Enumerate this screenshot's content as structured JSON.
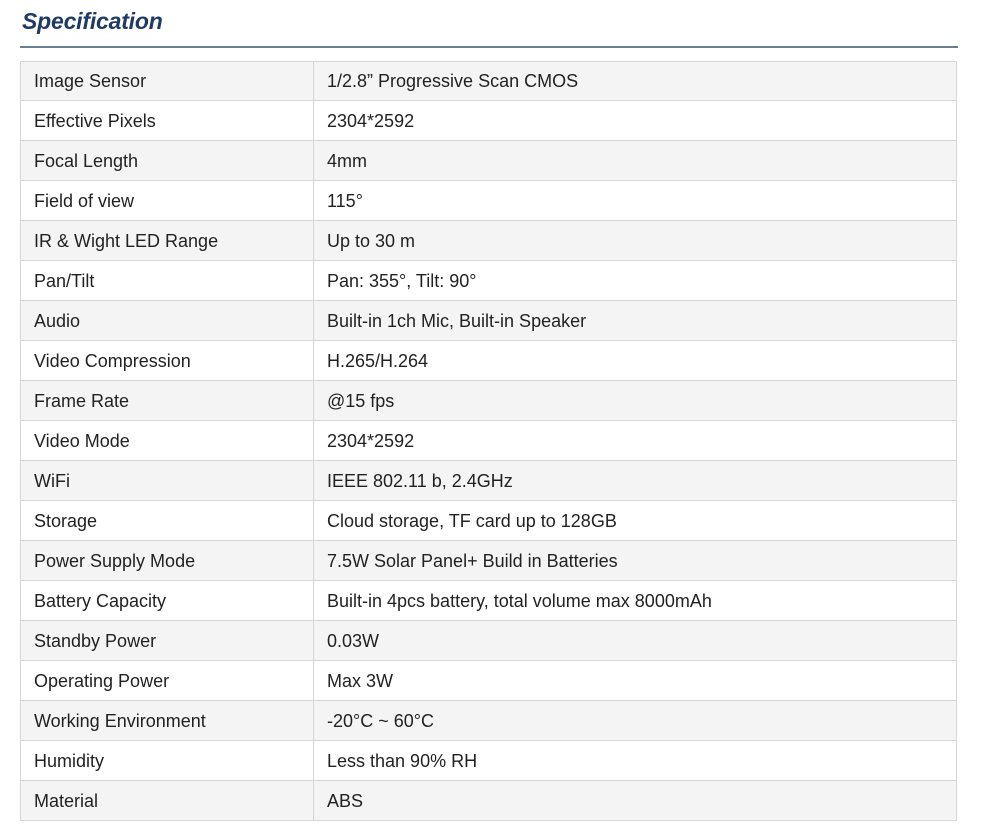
{
  "section": {
    "title": "Specification"
  },
  "spec_table": {
    "rows": [
      {
        "label": "Image Sensor",
        "value": "1/2.8” Progressive Scan CMOS"
      },
      {
        "label": "Effective Pixels",
        "value": "2304*2592"
      },
      {
        "label": "Focal Length",
        "value": "4mm"
      },
      {
        "label": "Field of view",
        "value": "115°"
      },
      {
        "label": "IR & Wight LED Range",
        "value": "Up to 30 m"
      },
      {
        "label": "Pan/Tilt",
        "value": "Pan: 355°, Tilt: 90°"
      },
      {
        "label": "Audio",
        "value": "Built-in 1ch Mic, Built-in Speaker"
      },
      {
        "label": "Video Compression",
        "value": "H.265/H.264"
      },
      {
        "label": "Frame Rate",
        "value": "@15 fps"
      },
      {
        "label": "Video Mode",
        "value": "2304*2592"
      },
      {
        "label": "WiFi",
        "value": "IEEE 802.11 b, 2.4GHz"
      },
      {
        "label": "Storage",
        "value": "Cloud storage, TF card up to 128GB"
      },
      {
        "label": "Power Supply Mode",
        "value": "7.5W Solar Panel+ Build in Batteries"
      },
      {
        "label": "Battery Capacity",
        "value": "Built-in 4pcs battery, total volume max 8000mAh"
      },
      {
        "label": "Standby Power",
        "value": "0.03W"
      },
      {
        "label": "Operating Power",
        "value": "Max 3W"
      },
      {
        "label": "Working Environment",
        "value": "-20°C ~ 60°C"
      },
      {
        "label": "Humidity",
        "value": "Less than 90% RH"
      },
      {
        "label": "Material",
        "value": "ABS"
      }
    ]
  },
  "colors": {
    "heading": "#1f3b64",
    "rule": "#6b7d95",
    "row_alt": "#f4f4f4",
    "border": "#d6d6d6",
    "text": "#222222"
  }
}
